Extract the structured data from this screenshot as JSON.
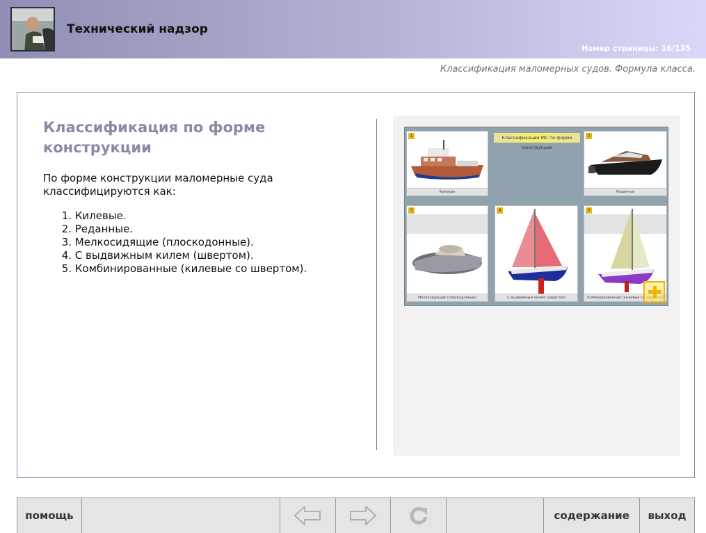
{
  "header": {
    "title": "Технический надзор",
    "page_label": "Номер страницы: 16/135"
  },
  "breadcrumb": "Классификация маломерных судов. Формула класса.",
  "content": {
    "heading": "Классификация по форме конструкции",
    "intro": "По форме конструкции маломерные суда классифицируются как:",
    "items": [
      {
        "n": "1.",
        "text": "Килевые."
      },
      {
        "n": "2.",
        "text": "Реданные."
      },
      {
        "n": "3.",
        "text": "Мелкосидящие (плоскодонные)."
      },
      {
        "n": "4.",
        "text": "С выдвижным килем (швертом)."
      },
      {
        "n": "5.",
        "text": "Комбинированные (килевые со швертом)."
      }
    ]
  },
  "figure": {
    "title": "Классификация МС по форме конструкции",
    "tiles": [
      {
        "badge": "1",
        "caption": "Килевые"
      },
      {
        "badge": "2",
        "caption": "Реданные"
      },
      {
        "badge": "3",
        "caption": "Мелкосидящие (плоскодонные)"
      },
      {
        "badge": "4",
        "caption": "С выдвижным килем (швертом)"
      },
      {
        "badge": "5",
        "caption": "Комбинированные (килевые со швертом)"
      }
    ]
  },
  "footer": {
    "help": "помощь",
    "contents": "содержание",
    "exit": "выход"
  },
  "colors": {
    "header_left": "#8f8eb4",
    "header_right": "#d8d8f8",
    "heading": "#8b8aa6",
    "frame_border": "#8a87ab",
    "footer_bg": "#e5e5e5"
  },
  "icons": [
    "user-photo",
    "zoom-plus-icon",
    "arrow-left-icon",
    "arrow-right-icon",
    "refresh-icon"
  ]
}
